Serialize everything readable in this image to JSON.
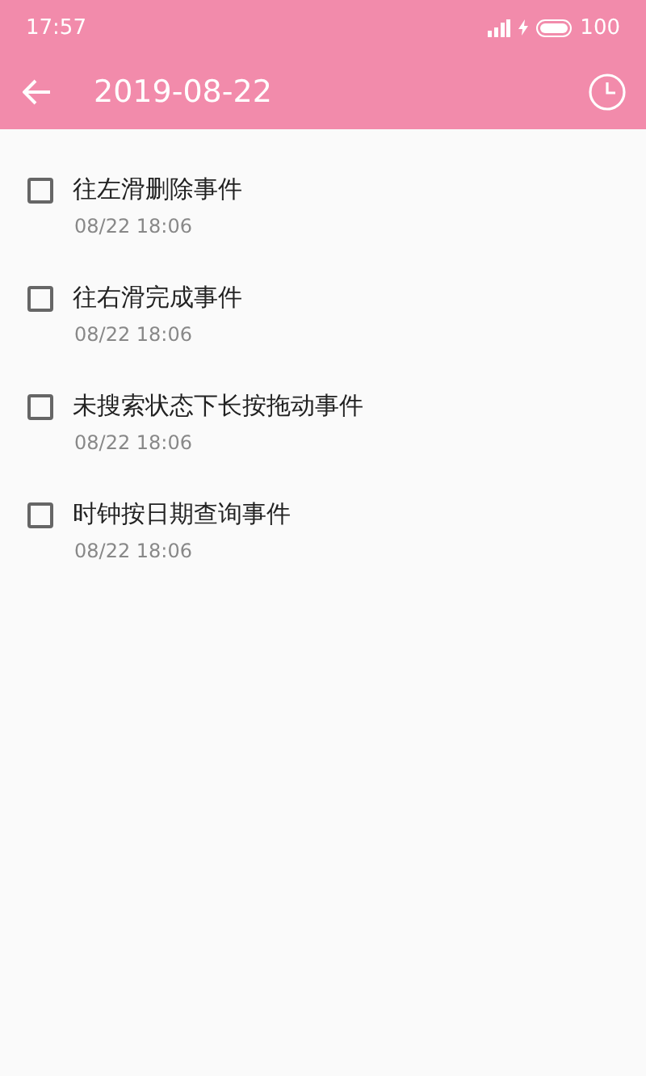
{
  "status_bar": {
    "time": "17:57",
    "battery": "100"
  },
  "toolbar": {
    "title": "2019-08-22"
  },
  "items": [
    {
      "title": "往左滑删除事件",
      "time": "08/22 18:06",
      "checked": false
    },
    {
      "title": "往右滑完成事件",
      "time": "08/22 18:06",
      "checked": false
    },
    {
      "title": "未搜索状态下长按拖动事件",
      "time": "08/22 18:06",
      "checked": false
    },
    {
      "title": "时钟按日期查询事件",
      "time": "08/22 18:06",
      "checked": false
    }
  ]
}
